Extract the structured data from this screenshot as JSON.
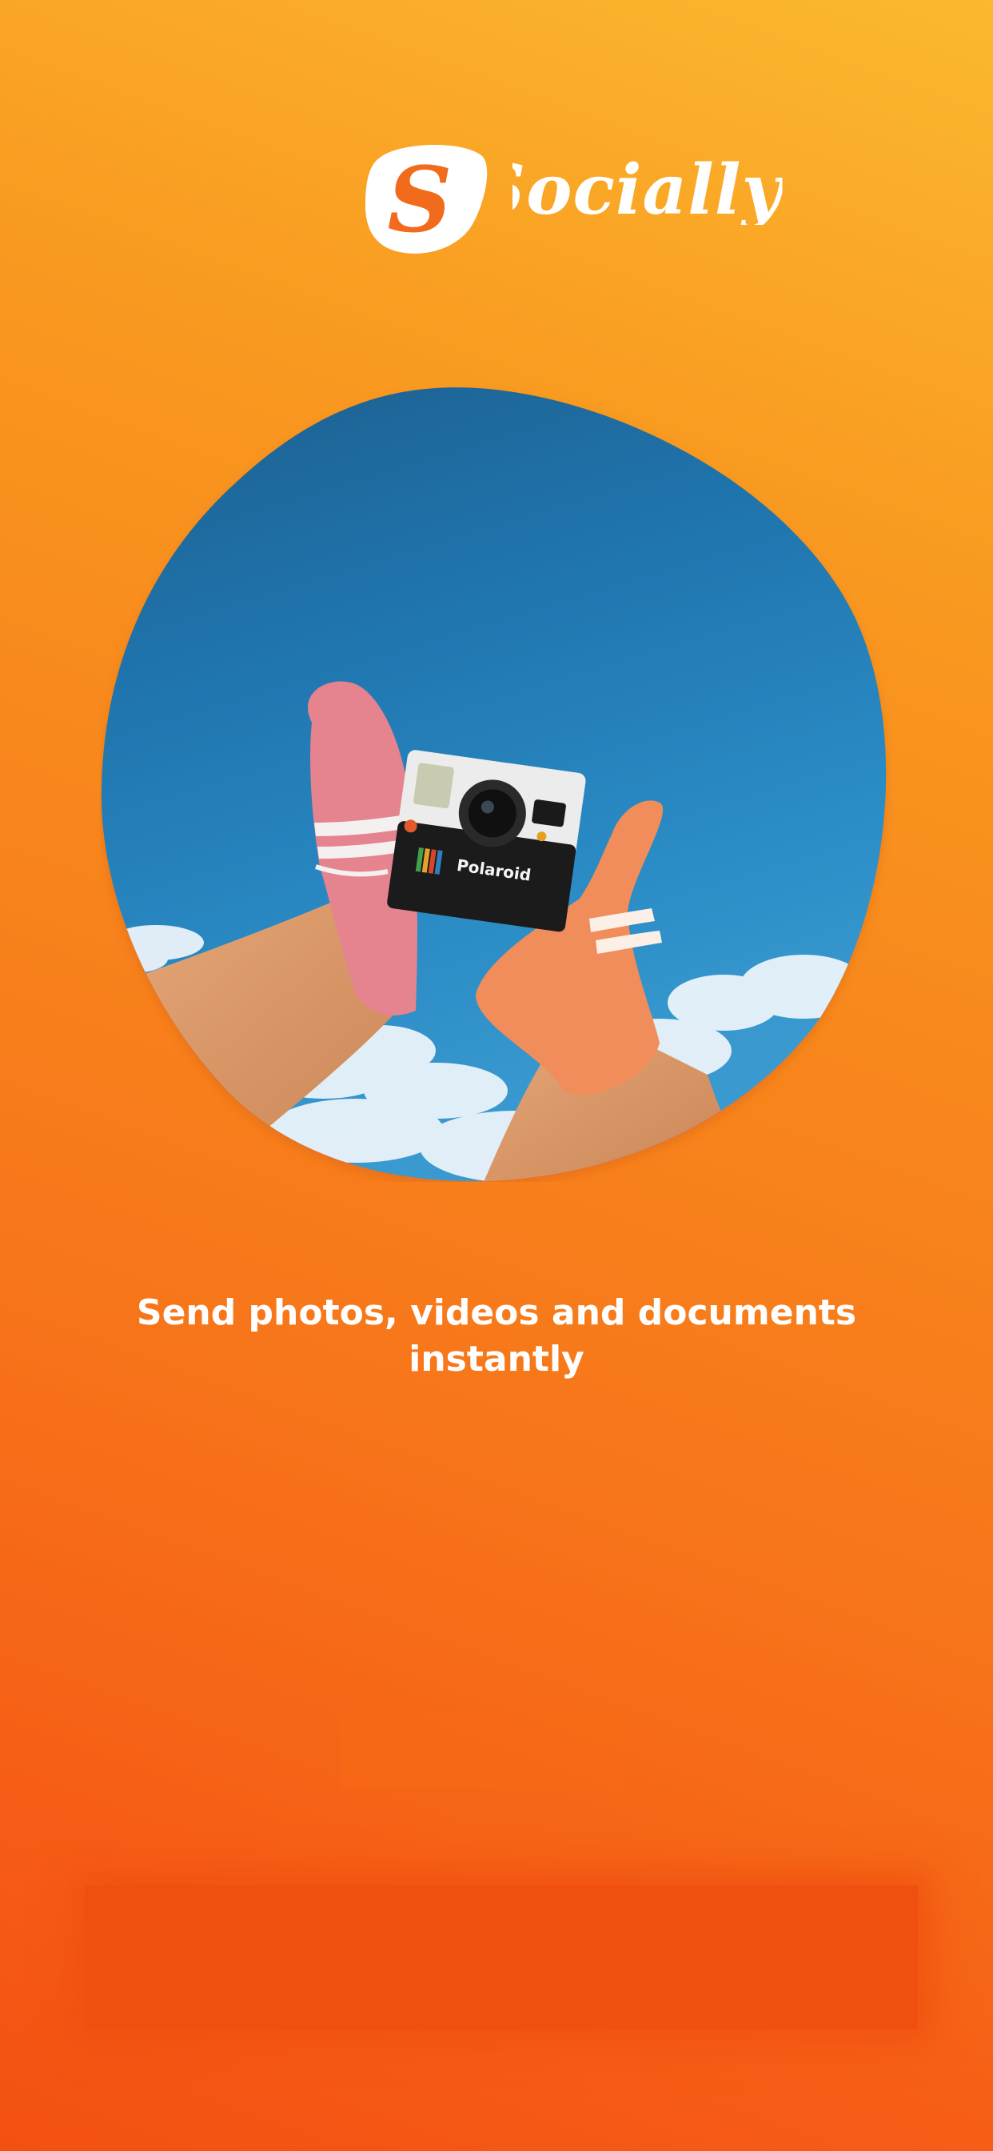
{
  "app": {
    "logo_text": "Socially",
    "logo_initial": "S"
  },
  "hero": {
    "image_description_icon": "photo-hero-image"
  },
  "onboarding": {
    "headline": "Send photos, videos and documents instantly"
  },
  "colors": {
    "gradient_top": "#FBB92F",
    "gradient_mid": "#F8861C",
    "gradient_bottom": "#F45012",
    "logo_s_color": "#F26A1B",
    "text": "#FFFFFF",
    "sky": "#2A86C0"
  }
}
